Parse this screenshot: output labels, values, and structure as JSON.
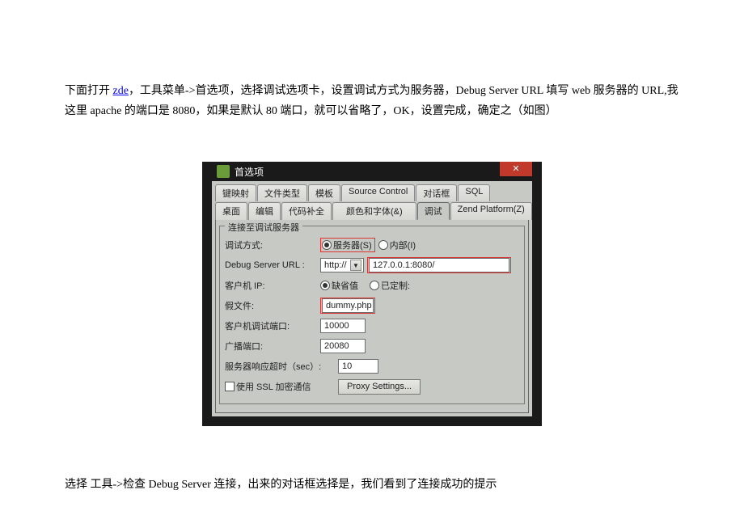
{
  "intro": {
    "before_link": "下面打开 ",
    "link_text": "zde",
    "after_link": "，工具菜单->首选项，选择调试选项卡，设置调试方式为服务器，Debug Server URL 填写 web 服务器的 URL,我这里 apache 的端口是 8080，如果是默认 80 端口，就可以省略了，OK，设置完成，确定之（如图）"
  },
  "outro": "选择 工具->检查 Debug Server 连接，出来的对话框选择是，我们看到了连接成功的提示",
  "dialog": {
    "title": "首选项",
    "tabs_row1": [
      "键映射",
      "文件类型",
      "模板",
      "Source Control",
      "对话框",
      "SQL"
    ],
    "tabs_row2": [
      "桌面",
      "编辑",
      "代码补全",
      "颜色和字体(&)",
      "调试",
      "Zend Platform(Z)"
    ],
    "active_tab": "调试",
    "group_title": "连接至调试服务器",
    "labels": {
      "debug_mode": "调试方式:",
      "server_radio": "服务器(S)",
      "internal_radio": "内部(I)",
      "debug_url": "Debug Server URL :",
      "client_ip": "客户机 IP:",
      "default_radio": "缺省值",
      "custom_radio": "已定制:",
      "fake_file": "假文件:",
      "client_port": "客户机调试端口:",
      "broadcast_port": "广播端口:",
      "timeout": "服务器响应超时（sec）:",
      "ssl": "使用 SSL 加密通信",
      "proxy_btn": "Proxy Settings..."
    },
    "values": {
      "protocol": "http://",
      "url": "127.0.0.1:8080/",
      "fake_file": "dummy.php",
      "client_port": "10000",
      "broadcast_port": "20080",
      "timeout": "10"
    }
  }
}
